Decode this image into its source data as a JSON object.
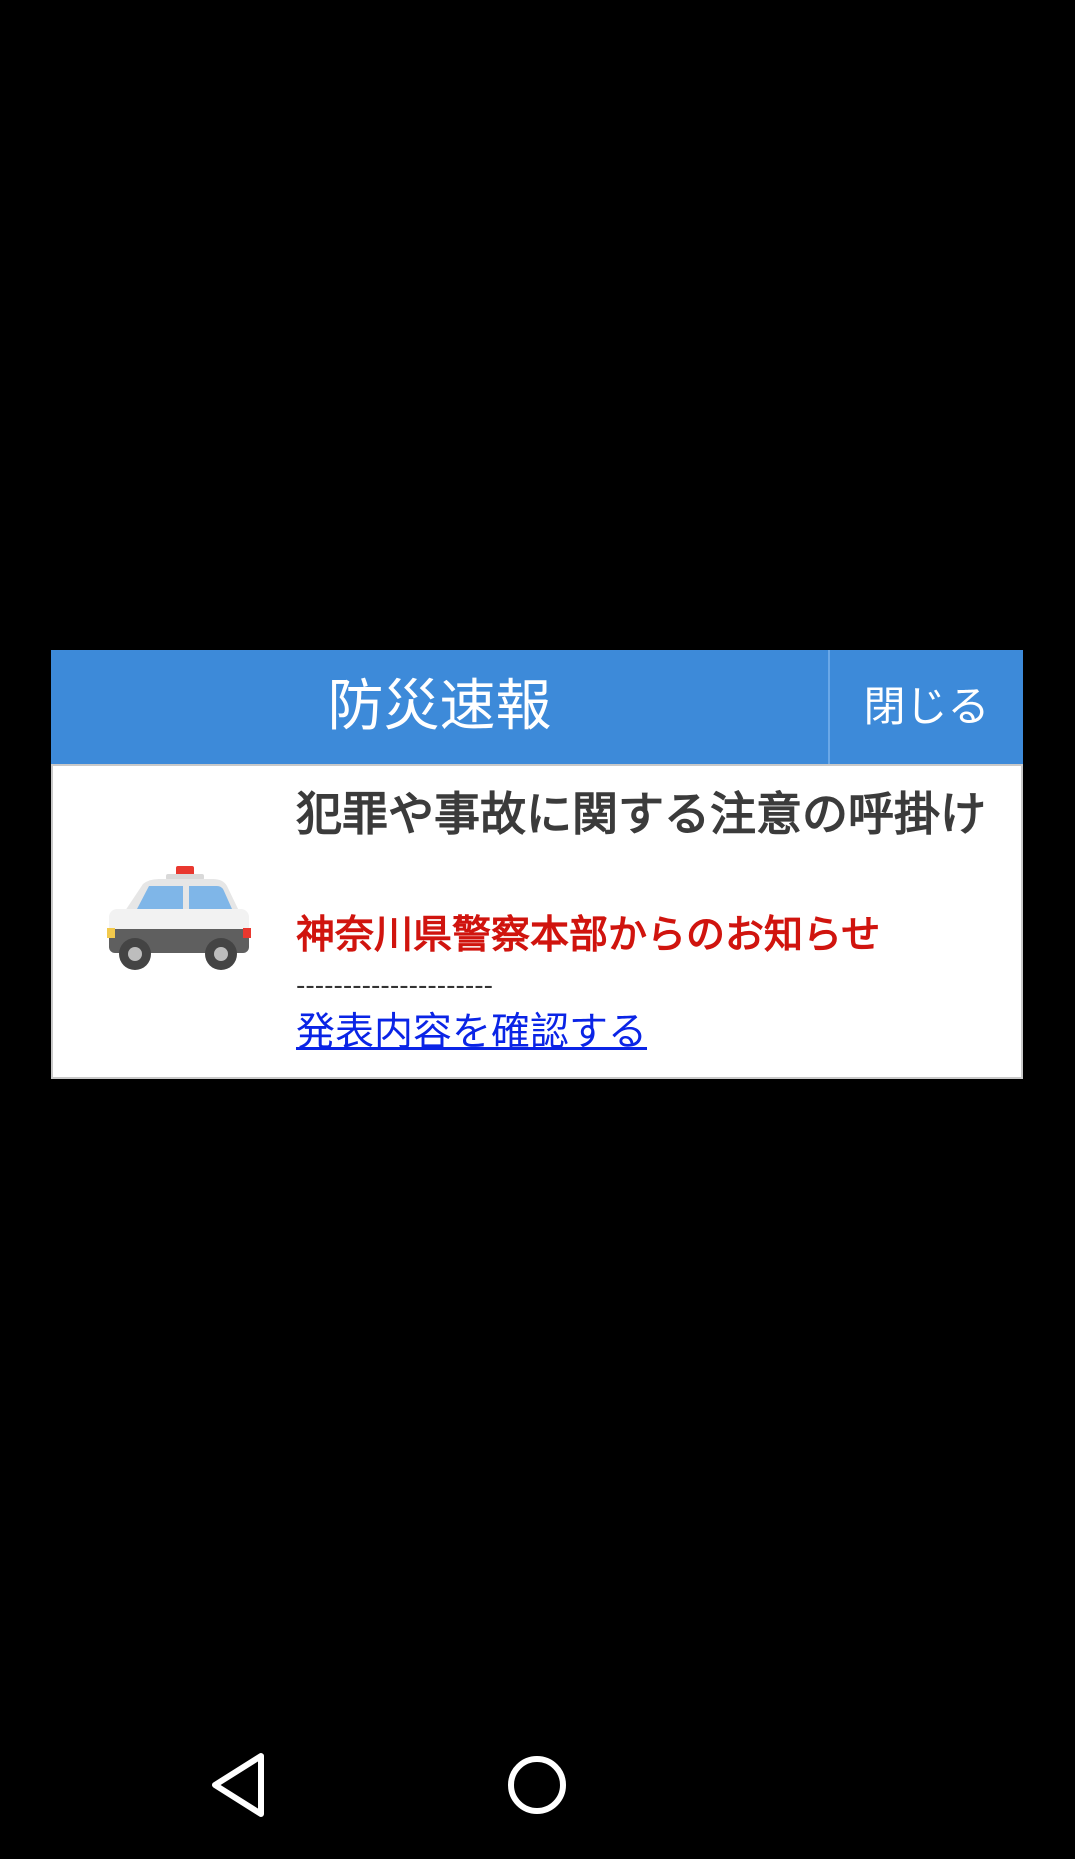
{
  "dialog": {
    "title": "防災速報",
    "close_label": "閉じる",
    "icon": "police-car-icon",
    "alert_title": "犯罪や事故に関する注意の呼掛け",
    "alert_source": "神奈川県警察本部からのお知らせ",
    "separator": "---------------------",
    "link_label": "発表内容を確認する"
  },
  "navigation": {
    "back_icon": "back-triangle-icon",
    "home_icon": "home-circle-icon"
  },
  "colors": {
    "header": "#3d8ad9",
    "source_text": "#d0140e",
    "link": "#0a24e6"
  }
}
